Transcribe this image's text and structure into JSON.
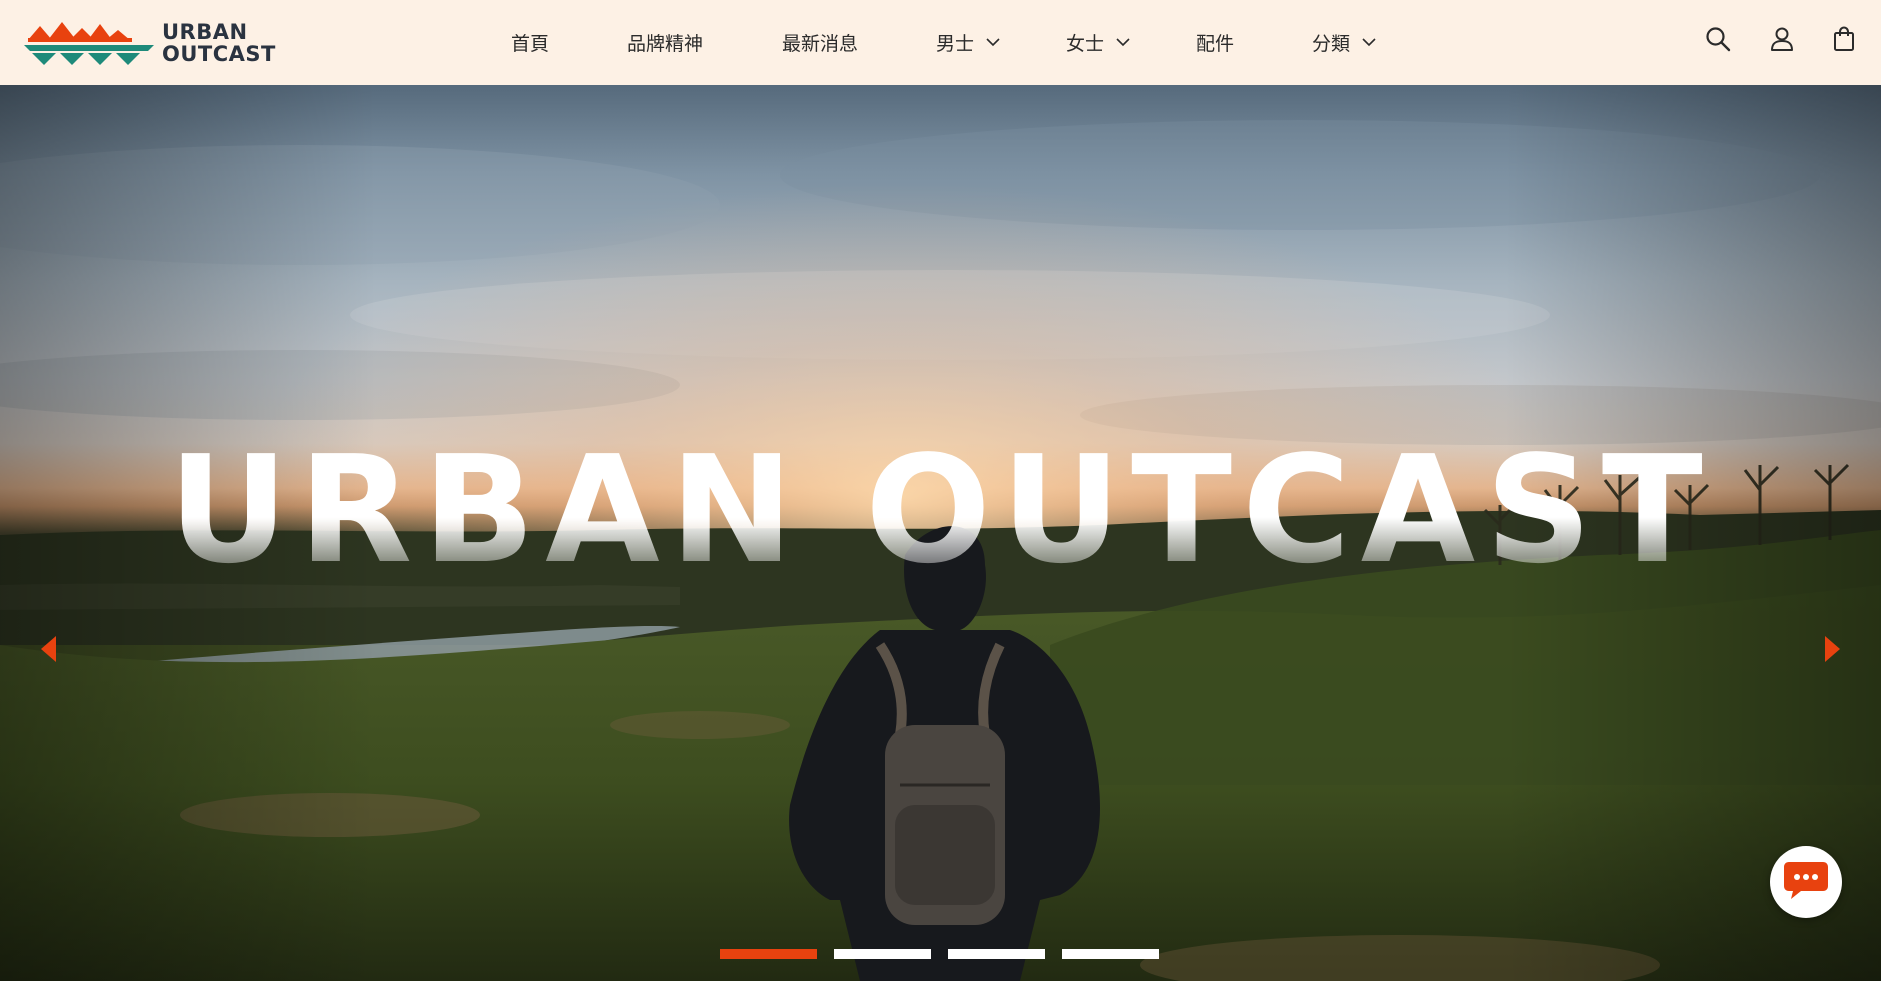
{
  "brand": {
    "line1": "URBAN",
    "line2": "OUTCAST",
    "text_color": "#2a3340",
    "mark_colors": [
      "#e8420f",
      "#1e8a7a"
    ]
  },
  "nav": {
    "items": [
      {
        "label": "首頁",
        "has_dropdown": false
      },
      {
        "label": "品牌精神",
        "has_dropdown": false
      },
      {
        "label": "最新消息",
        "has_dropdown": false
      },
      {
        "label": "男士",
        "has_dropdown": true
      },
      {
        "label": "女士",
        "has_dropdown": true
      },
      {
        "label": "配件",
        "has_dropdown": false
      },
      {
        "label": "分類",
        "has_dropdown": true
      }
    ],
    "icons": [
      "search-icon",
      "account-icon",
      "cart-icon"
    ]
  },
  "hero": {
    "title": "URBAN OUTCAST",
    "prev_icon": "arrow-left-icon",
    "next_icon": "arrow-right-icon",
    "slides_total": 4,
    "active_slide": 1
  },
  "chat": {
    "icon": "chat-bubble-icon"
  },
  "colors": {
    "header_bg": "#fdf1e5",
    "accent": "#e8420f",
    "nav_text": "#2b2b2b"
  }
}
